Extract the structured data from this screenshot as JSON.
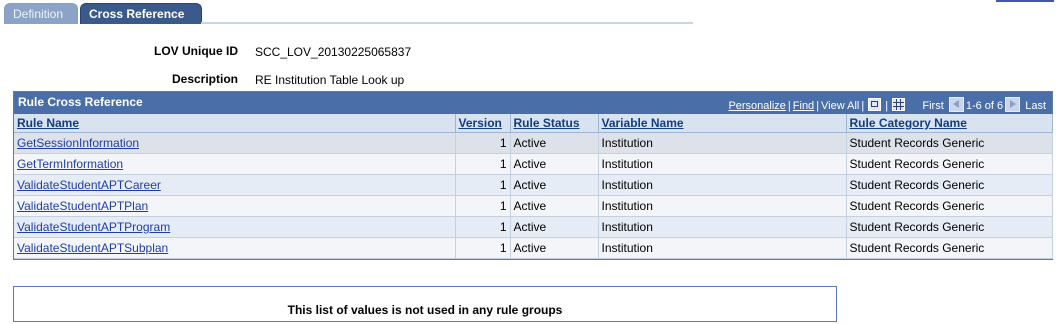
{
  "tabs": [
    {
      "label": "Definition"
    },
    {
      "label": "Cross Reference"
    }
  ],
  "header": {
    "lov_id_label": "LOV Unique ID",
    "lov_id_value": "SCC_LOV_20130225065837",
    "description_label": "Description",
    "description_value": "RE Institution Table Look up"
  },
  "grid": {
    "title": "Rule Cross Reference",
    "personalize": "Personalize",
    "find": "Find",
    "view_all": "View All",
    "first": "First",
    "range": "1-6 of 6",
    "last": "Last",
    "columns": [
      "Rule Name",
      "Version",
      "Rule Status",
      "Variable Name",
      "Rule Category Name"
    ],
    "rows": [
      {
        "rule_name": "GetSessionInformation",
        "version": "1",
        "status": "Active",
        "variable": "Institution",
        "category": "Student Records Generic"
      },
      {
        "rule_name": "GetTermInformation",
        "version": "1",
        "status": "Active",
        "variable": "Institution",
        "category": "Student Records Generic"
      },
      {
        "rule_name": "ValidateStudentAPTCareer",
        "version": "1",
        "status": "Active",
        "variable": "Institution",
        "category": "Student Records Generic"
      },
      {
        "rule_name": "ValidateStudentAPTPlan",
        "version": "1",
        "status": "Active",
        "variable": "Institution",
        "category": "Student Records Generic"
      },
      {
        "rule_name": "ValidateStudentAPTProgram",
        "version": "1",
        "status": "Active",
        "variable": "Institution",
        "category": "Student Records Generic"
      },
      {
        "rule_name": "ValidateStudentAPTSubplan",
        "version": "1",
        "status": "Active",
        "variable": "Institution",
        "category": "Student Records Generic"
      }
    ]
  },
  "groups_message": "This list of values is not used in any rule groups",
  "colors": {
    "grid_header": "#4a6ea8",
    "active_tab": "#3a5a8c",
    "inactive_tab": "#8aa3c7",
    "link": "#1e3ea8"
  }
}
